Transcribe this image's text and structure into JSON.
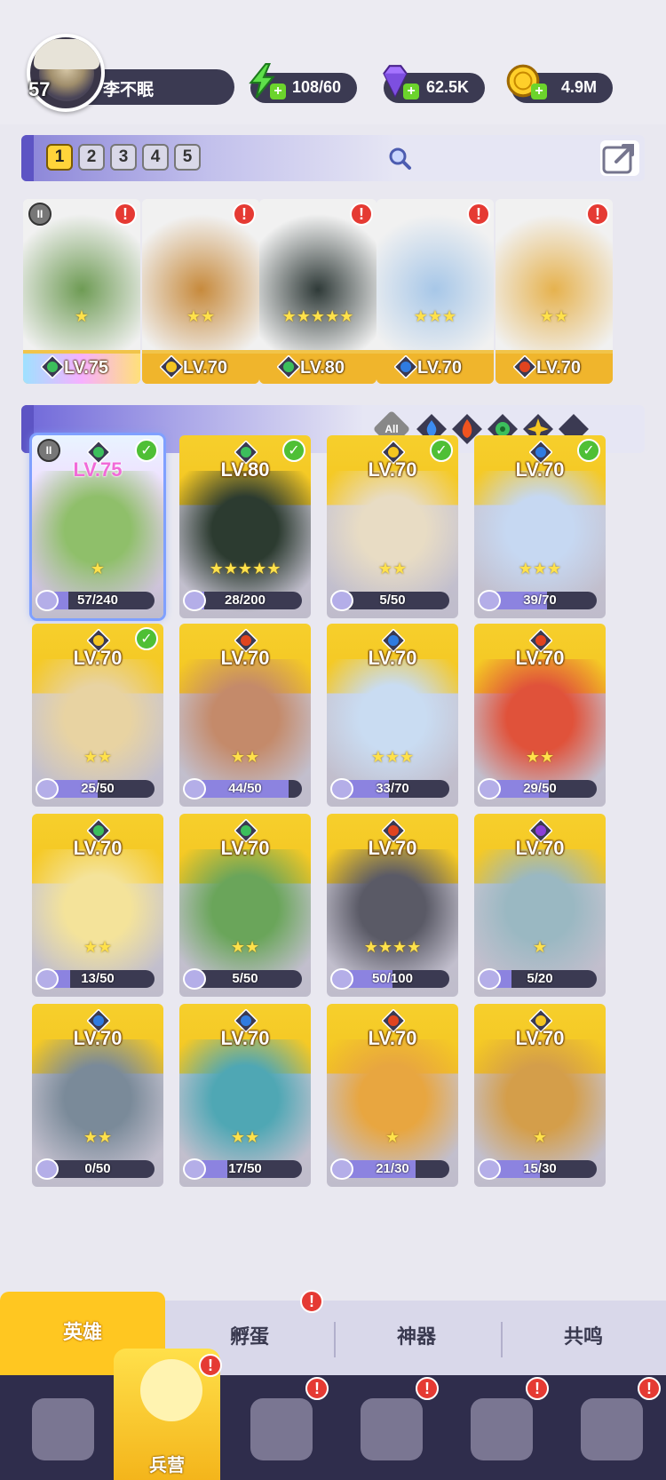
{
  "player": {
    "level": "57",
    "name": "李不眠"
  },
  "resources": {
    "energy": "108/60",
    "gems": "62.5K",
    "gold": "4.9M"
  },
  "team_tabs": [
    "1",
    "2",
    "3",
    "4",
    "5"
  ],
  "team": [
    {
      "level": "LV.75",
      "element": "green",
      "stars": "★",
      "alert": "!",
      "rank": "II"
    },
    {
      "level": "LV.70",
      "element": "gold",
      "stars": "★★",
      "alert": "!"
    },
    {
      "level": "LV.80",
      "element": "green",
      "stars": "★★★★★",
      "alert": "!"
    },
    {
      "level": "LV.70",
      "element": "blue",
      "stars": "★★★",
      "alert": "!"
    },
    {
      "level": "LV.70",
      "element": "red",
      "stars": "★★",
      "alert": "!"
    }
  ],
  "filters": {
    "all_label": "All"
  },
  "heroes": [
    {
      "level": "LV.75",
      "element": "green",
      "stars": "★",
      "progress": "57/240",
      "rank": "II",
      "check": "✓"
    },
    {
      "level": "LV.80",
      "element": "green",
      "stars": "★★★★★",
      "progress": "28/200",
      "check": "✓"
    },
    {
      "level": "LV.70",
      "element": "gold",
      "stars": "★★",
      "progress": "5/50",
      "check": "✓"
    },
    {
      "level": "LV.70",
      "element": "blue",
      "stars": "★★★",
      "progress": "39/70",
      "check": "✓"
    },
    {
      "level": "LV.70",
      "element": "gold",
      "stars": "★★",
      "progress": "25/50",
      "check": "✓"
    },
    {
      "level": "LV.70",
      "element": "red",
      "stars": "★★",
      "progress": "44/50"
    },
    {
      "level": "LV.70",
      "element": "blue",
      "stars": "★★★",
      "progress": "33/70"
    },
    {
      "level": "LV.70",
      "element": "red",
      "stars": "★★",
      "progress": "29/50"
    },
    {
      "level": "LV.70",
      "element": "green",
      "stars": "★★",
      "progress": "13/50"
    },
    {
      "level": "LV.70",
      "element": "green",
      "stars": "★★",
      "progress": "5/50"
    },
    {
      "level": "LV.70",
      "element": "red",
      "stars": "★★★★",
      "progress": "50/100"
    },
    {
      "level": "LV.70",
      "element": "purple",
      "stars": "★",
      "progress": "5/20"
    },
    {
      "level": "LV.70",
      "element": "blue",
      "stars": "★★",
      "progress": "0/50"
    },
    {
      "level": "LV.70",
      "element": "blue",
      "stars": "★★",
      "progress": "17/50"
    },
    {
      "level": "LV.70",
      "element": "red",
      "stars": "★",
      "progress": "21/30"
    },
    {
      "level": "LV.70",
      "element": "gold",
      "stars": "★",
      "progress": "15/30"
    }
  ],
  "subtabs": {
    "heroes": "英雄",
    "hatch": "孵蛋",
    "artifact": "神器",
    "resonance": "共鸣",
    "hatch_alert": "!"
  },
  "nav": {
    "barracks": "兵营",
    "alert": "!"
  },
  "colors": {
    "accent": "#5d54c4",
    "gold": "#f4c520",
    "panel": "#3b3a52",
    "green": "#3cbf5c",
    "blue": "#2f7be0",
    "red": "#e0441f",
    "purple": "#8a3fd6"
  }
}
